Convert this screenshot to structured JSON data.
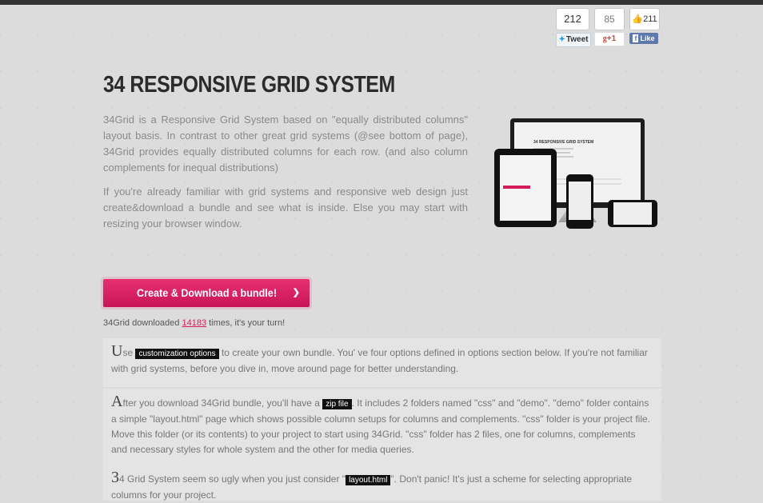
{
  "social": {
    "tweet_count": "212",
    "tweet_label": "Tweet",
    "gplus_count": "85",
    "gplus_label": "+1",
    "fb_count": "211",
    "fb_label": "Like"
  },
  "header": {
    "title": "34 RESPONSIVE GRID SYSTEM"
  },
  "intro": {
    "p1": "34Grid is a Responsive Grid System based on \"equally distributed columns\" layout basis. In contrast to other great grid systems (@see bottom of page), 34Grid provides equally distributed columns for each row. (and also column complements for inequal distributions)",
    "p2": "If you're already familiar with grid systems and responsive web design just create&download a bundle and see what is inside. Else you may start with resizing your browser window."
  },
  "preview": {
    "screen_title": "34 RESPONSIVE GRID SYSTEM"
  },
  "download": {
    "button_label": "Create & Download a bundle!",
    "count_prefix": "34Grid downloaded ",
    "count": "14183",
    "count_suffix": " times, it's your turn!"
  },
  "panels": [
    {
      "dropcap": "U",
      "before": "se ",
      "tag": "customization options",
      "after": " to create your own bundle. You' ve four options defined in options section below. If you're not familiar with grid systems, before you dive in, move around page for better understanding."
    },
    {
      "dropcap": "A",
      "before": "fter you download 34Grid bundle, you'll have a ",
      "tag": "zip file",
      "after": ". It includes 2 folders named \"css\" and \"demo\". \"demo\" folder contains a simple \"layout.html\" page which shows possible column setups for columns and complements. \"css\" folder is your project file. Move this folder (or its contents) to your project to start using 34Grid. \"css\" folder has 2 files, one for columns, complements and necessary styles for whole system and the other for media queries."
    },
    {
      "dropcap": "3",
      "before": "4 Grid System seem so ugly when you just consider \"",
      "tag": "layout.html",
      "after": "\". Don't panic! It's just a scheme for selecting appropriate columns for your project."
    }
  ]
}
